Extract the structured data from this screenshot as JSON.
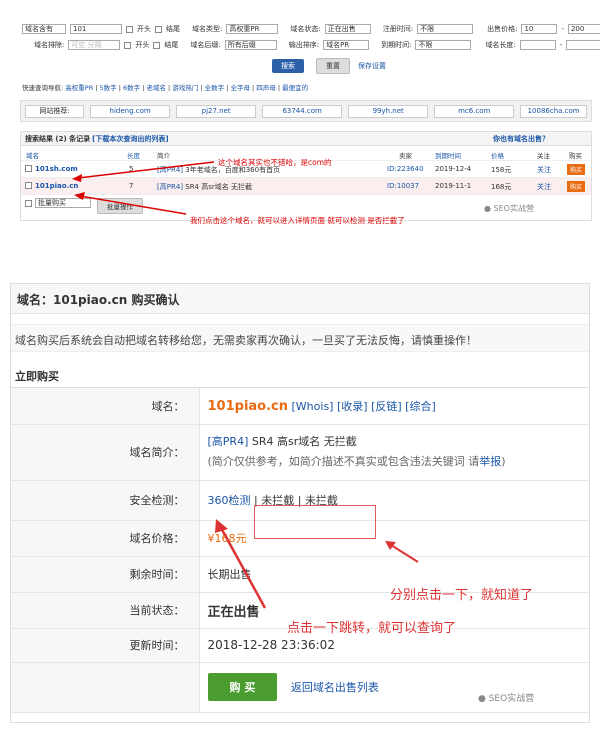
{
  "search": {
    "f_domain_type_select": "域名含有",
    "f_domain_value": "101",
    "f_start": "开头",
    "f_end": "结尾",
    "f_type_label": "域名类型:",
    "f_type_value": "高权重PR",
    "f_status_label": "域名状态:",
    "f_status_value": "正在出售",
    "f_reg_label": "注册时间:",
    "f_reg_value": "不限",
    "f_price_label": "出售价格:",
    "f_price_min": "10",
    "f_price_sep": "-",
    "f_price_max": "200",
    "f_exclude_label": "域名排除:",
    "f_exclude_placeholder": "可空 分隔",
    "f_suffix_label": "域名后缀:",
    "f_suffix_value": "所有后缀",
    "f_sort_label": "输出排序:",
    "f_sort_value": "域名PR",
    "f_expire_label": "到期时间:",
    "f_expire_value": "不限",
    "f_len_label": "域名长度:",
    "f_len_sep": "-",
    "search_btn": "搜索",
    "reset_btn": "重置",
    "save_link": "保存设置"
  },
  "quick": {
    "label": "快速查询导航:",
    "items": [
      "高权重PR",
      "5数字",
      "6数字",
      "老域名",
      "游戏热门",
      "全数字",
      "全字母",
      "四声母",
      "最便宜的"
    ]
  },
  "recommend": {
    "label": "网站推荐:",
    "items": [
      "hideng.com",
      "pj27.net",
      "63744.com",
      "99yh.net",
      "mc6.com",
      "10086cha.com"
    ]
  },
  "results": {
    "head_prefix": "搜索结果 (",
    "count": "2",
    "head_mid": ") 条记录",
    "download_link": "[下载本次查询出的列表]",
    "help_link": "你也有域名出售？",
    "columns": [
      "域名",
      "长度",
      "简介",
      "卖家",
      "到期时间",
      "价格",
      "关注",
      "购买"
    ],
    "rows": [
      {
        "domain": "101sh.com",
        "len": "5",
        "desc_tag": "[高PR4]",
        "desc": "3年老域名，百度和360有首页",
        "seller": "ID:223640",
        "expire": "2019-12-4",
        "price": "158元",
        "follow": "关注",
        "buy": "购买"
      },
      {
        "domain": "101piao.cn",
        "len": "7",
        "desc_tag": "[高PR4]",
        "desc": "SR4 高sr域名 无拦截",
        "seller": "ID:10037",
        "expire": "2019-11-1",
        "price": "168元",
        "follow": "关注",
        "buy": "购买"
      }
    ],
    "bulk_buy": "批量购买",
    "bulk_op": "批量操作"
  },
  "annotations": {
    "top_note1": "这个域名其实也不错哈，是com的",
    "top_note2": "我们点击这个域名，就可以进入详情页面 就可以检测 是否拦截了",
    "bottom_note1": "分别点击一下，就知道了",
    "bottom_note2": "点击一下跳转，就可以查询了",
    "watermark": "SEO实战营"
  },
  "confirm": {
    "title": "域名：101piao.cn 购买确认",
    "notice": "域名购买后系统会自动把域名转移给您，无需卖家再次确认，一旦买了无法反悔，请慎重操作！",
    "section": "立即购买",
    "rows": {
      "domain_label": "域名：",
      "domain": "101piao.cn",
      "whois": "[Whois]",
      "shoulu": "[收录]",
      "fanlian": "[反链]",
      "zonghe": "[综合]",
      "intro_label": "域名简介：",
      "intro_tag": "[高PR4]",
      "intro_text": "SR4 高sr域名 无拦截",
      "intro_disclaimer": "(简介仅供参考，如简介描述不真实或包含违法关键词 请",
      "report": "举报",
      "intro_close": ")",
      "security_label": "安全检测：",
      "check_360": "360检测",
      "check_sep1": "|",
      "check_a": "未拦截",
      "check_sep2": "|",
      "check_b": "未拦截",
      "price_label": "域名价格：",
      "price": "¥168元",
      "remain_label": "剩余时间：",
      "remain": "长期出售",
      "status_label": "当前状态：",
      "status": "正在出售",
      "update_label": "更新时间：",
      "update": "2018-12-28 23:36:02"
    },
    "buy_btn": "购 买",
    "back_link": "返回域名出售列表"
  }
}
